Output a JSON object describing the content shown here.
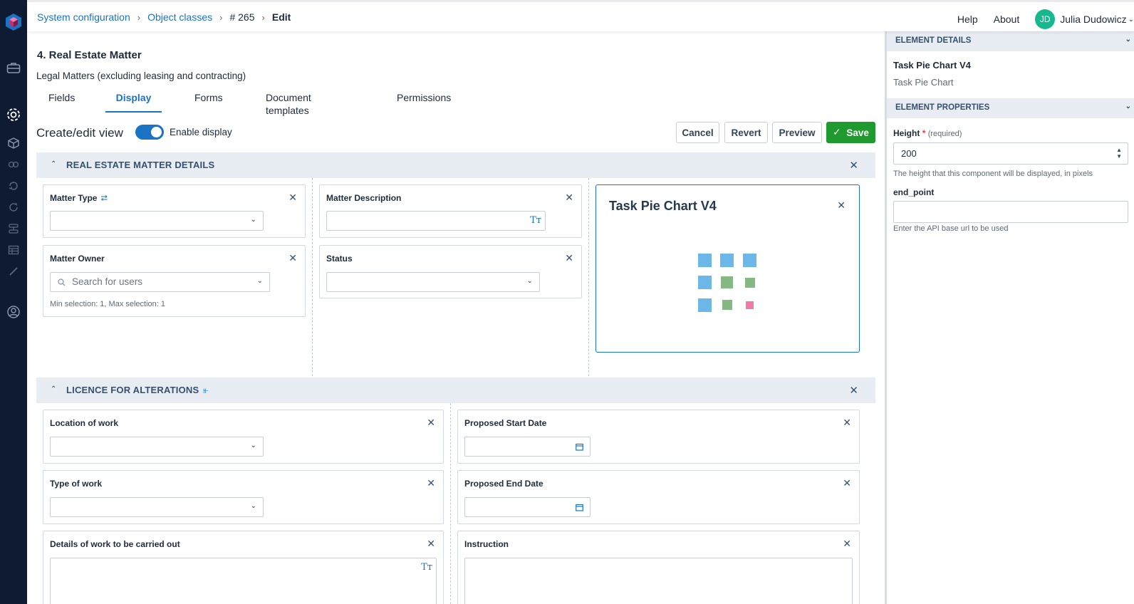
{
  "breadcrumb": {
    "items": [
      "System configuration",
      "Object classes",
      "# 265",
      "Edit"
    ]
  },
  "topnav": {
    "help": "Help",
    "about": "About",
    "avatar_initials": "JD",
    "user_name": "Julia Dudowicz"
  },
  "header": {
    "title": "4. Real Estate Matter",
    "subtitle": "Legal Matters (excluding leasing and contracting)"
  },
  "tabs": [
    {
      "label": "Fields"
    },
    {
      "label": "Display"
    },
    {
      "label": "Forms"
    },
    {
      "label": "Document templates"
    },
    {
      "label": "Permissions"
    }
  ],
  "view": {
    "title": "Create/edit view",
    "toggle_label": "Enable display",
    "cancel": "Cancel",
    "revert": "Revert",
    "preview": "Preview",
    "save": "Save"
  },
  "section1": {
    "title": "REAL ESTATE MATTER DETAILS",
    "matter_type": "Matter Type",
    "matter_description": "Matter Description",
    "matter_owner": "Matter Owner",
    "owner_placeholder": "Search for users",
    "owner_hint": "Min selection: 1, Max selection: 1",
    "status": "Status",
    "pie_title": "Task Pie Chart V4"
  },
  "section2": {
    "title": "LICENCE FOR ALTERATIONS",
    "location_of_work": "Location of work",
    "proposed_start_date": "Proposed Start Date",
    "type_of_work": "Type of work",
    "proposed_end_date": "Proposed End Date",
    "details_of_work": "Details of work to be carried out",
    "instruction": "Instruction"
  },
  "panel": {
    "element_details": "ELEMENT DETAILS",
    "element_name": "Task Pie Chart V4",
    "element_type": "Task Pie Chart",
    "element_properties": "ELEMENT PROPERTIES",
    "height_label": "Height",
    "required_marker": "*",
    "required_text": "(required)",
    "height_value": "200",
    "height_hint": "The height that this component will be displayed, in pixels",
    "endpoint_label": "end_point",
    "endpoint_hint": "Enter the API base url to be used"
  },
  "colors": {
    "accent": "#1a73c4",
    "save": "#1e9a2e",
    "rail": "#0f1b33",
    "placeholder_blue": "#6bb8e8",
    "placeholder_green": "#86b884",
    "placeholder_pink": "#f07aa8"
  }
}
